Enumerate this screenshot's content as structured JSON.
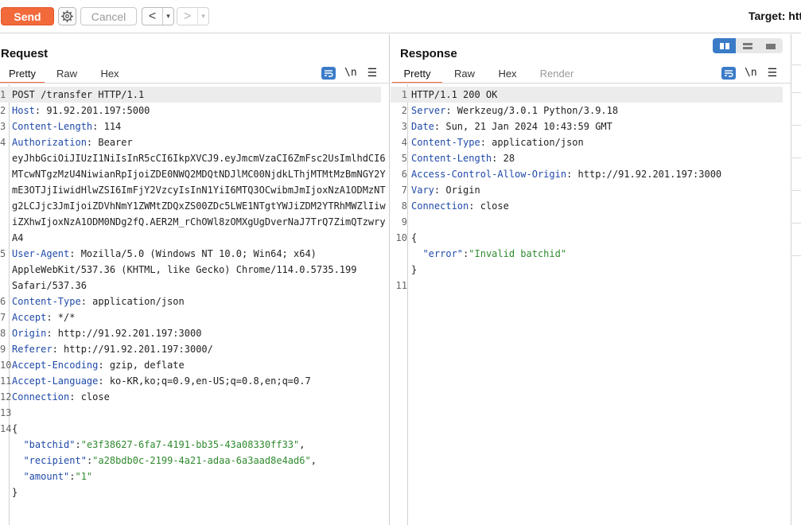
{
  "toolbar": {
    "send_label": "Send",
    "settings_icon": "gear-icon",
    "cancel_label": "Cancel",
    "back_glyph": "<",
    "forward_glyph": ">",
    "dropdown_glyph": "▾",
    "target_label": "Target: htt"
  },
  "request": {
    "title": "Request",
    "tabs": [
      "Pretty",
      "Raw",
      "Hex"
    ],
    "active_tab": "Pretty",
    "tool_nl": "\\n",
    "lines": [
      {
        "n": "1",
        "segments": [
          {
            "t": "POST /transfer HTTP/1.1",
            "c": ""
          }
        ],
        "hl": true
      },
      {
        "n": "2",
        "segments": [
          {
            "t": "Host",
            "c": "hdr"
          },
          {
            "t": ": 91.92.201.197:5000",
            "c": ""
          }
        ]
      },
      {
        "n": "3",
        "segments": [
          {
            "t": "Content-Length",
            "c": "hdr"
          },
          {
            "t": ": 114",
            "c": ""
          }
        ]
      },
      {
        "n": "4",
        "segments": [
          {
            "t": "Authorization",
            "c": "hdr"
          },
          {
            "t": ": Bearer",
            "c": ""
          }
        ]
      },
      {
        "n": "",
        "segments": [
          {
            "t": "eyJhbGciOiJIUzI1NiIsInR5cCI6IkpXVCJ9.eyJmcmVzaCI6ZmFsc2UsImlhdCI6",
            "c": ""
          }
        ]
      },
      {
        "n": "",
        "segments": [
          {
            "t": "MTcwNTgzMzU4NiwianRpIjoiZDE0NWQ2MDQtNDJlMC00NjdkLThjMTMtMzBmNGY2Y",
            "c": ""
          }
        ]
      },
      {
        "n": "",
        "segments": [
          {
            "t": "mE3OTJjIiwidHlwZSI6ImFjY2VzcyIsInN1YiI6MTQ3OCwibmJmIjoxNzA1ODMzNT",
            "c": ""
          }
        ]
      },
      {
        "n": "",
        "segments": [
          {
            "t": "g2LCJjc3JmIjoiZDVhNmY1ZWMtZDQxZS00ZDc5LWE1NTgtYWJiZDM2YTRhMWZlIiw",
            "c": ""
          }
        ]
      },
      {
        "n": "",
        "segments": [
          {
            "t": "iZXhwIjoxNzA1ODM0NDg2fQ.AER2M_rChOWl8zOMXgUgDverNaJ7TrQ7ZimQTzwry",
            "c": ""
          }
        ]
      },
      {
        "n": "",
        "segments": [
          {
            "t": "A4",
            "c": ""
          }
        ]
      },
      {
        "n": "5",
        "segments": [
          {
            "t": "User-Agent",
            "c": "hdr"
          },
          {
            "t": ": Mozilla/5.0 (Windows NT 10.0; Win64; x64)",
            "c": ""
          }
        ]
      },
      {
        "n": "",
        "segments": [
          {
            "t": "AppleWebKit/537.36 (KHTML, like Gecko) Chrome/114.0.5735.199",
            "c": ""
          }
        ]
      },
      {
        "n": "",
        "segments": [
          {
            "t": "Safari/537.36",
            "c": ""
          }
        ]
      },
      {
        "n": "6",
        "segments": [
          {
            "t": "Content-Type",
            "c": "hdr"
          },
          {
            "t": ": application/json",
            "c": ""
          }
        ]
      },
      {
        "n": "7",
        "segments": [
          {
            "t": "Accept",
            "c": "hdr"
          },
          {
            "t": ": */*",
            "c": ""
          }
        ]
      },
      {
        "n": "8",
        "segments": [
          {
            "t": "Origin",
            "c": "hdr"
          },
          {
            "t": ": http://91.92.201.197:3000",
            "c": ""
          }
        ]
      },
      {
        "n": "9",
        "segments": [
          {
            "t": "Referer",
            "c": "hdr"
          },
          {
            "t": ": http://91.92.201.197:3000/",
            "c": ""
          }
        ]
      },
      {
        "n": "10",
        "segments": [
          {
            "t": "Accept-Encoding",
            "c": "hdr"
          },
          {
            "t": ": gzip, deflate",
            "c": ""
          }
        ]
      },
      {
        "n": "11",
        "segments": [
          {
            "t": "Accept-Language",
            "c": "hdr"
          },
          {
            "t": ": ko-KR,ko;q=0.9,en-US;q=0.8,en;q=0.7",
            "c": ""
          }
        ]
      },
      {
        "n": "12",
        "segments": [
          {
            "t": "Connection",
            "c": "hdr"
          },
          {
            "t": ": close",
            "c": ""
          }
        ]
      },
      {
        "n": "13",
        "segments": []
      },
      {
        "n": "14",
        "segments": [
          {
            "t": "{",
            "c": ""
          }
        ]
      },
      {
        "n": "",
        "segments": [
          {
            "t": "  ",
            "c": ""
          },
          {
            "t": "\"batchid\"",
            "c": "json-key"
          },
          {
            "t": ":",
            "c": ""
          },
          {
            "t": "\"e3f38627-6fa7-4191-bb35-43a08330ff33\"",
            "c": "json-str"
          },
          {
            "t": ",",
            "c": ""
          }
        ]
      },
      {
        "n": "",
        "segments": [
          {
            "t": "  ",
            "c": ""
          },
          {
            "t": "\"recipient\"",
            "c": "json-key"
          },
          {
            "t": ":",
            "c": ""
          },
          {
            "t": "\"a28bdb0c-2199-4a21-adaa-6a3aad8e4ad6\"",
            "c": "json-str"
          },
          {
            "t": ",",
            "c": ""
          }
        ]
      },
      {
        "n": "",
        "segments": [
          {
            "t": "  ",
            "c": ""
          },
          {
            "t": "\"amount\"",
            "c": "json-key"
          },
          {
            "t": ":",
            "c": ""
          },
          {
            "t": "\"1\"",
            "c": "json-str"
          }
        ]
      },
      {
        "n": "",
        "segments": [
          {
            "t": "}",
            "c": ""
          }
        ]
      }
    ]
  },
  "response": {
    "title": "Response",
    "tabs": [
      "Pretty",
      "Raw",
      "Hex",
      "Render"
    ],
    "active_tab": "Pretty",
    "disabled_tab": "Render",
    "tool_nl": "\\n",
    "lines": [
      {
        "n": "1",
        "segments": [
          {
            "t": "HTTP/1.1 200 OK",
            "c": ""
          }
        ],
        "hl": true
      },
      {
        "n": "2",
        "segments": [
          {
            "t": "Server",
            "c": "hdr"
          },
          {
            "t": ": Werkzeug/3.0.1 Python/3.9.18",
            "c": ""
          }
        ]
      },
      {
        "n": "3",
        "segments": [
          {
            "t": "Date",
            "c": "hdr"
          },
          {
            "t": ": Sun, 21 Jan 2024 10:43:59 GMT",
            "c": ""
          }
        ]
      },
      {
        "n": "4",
        "segments": [
          {
            "t": "Content-Type",
            "c": "hdr"
          },
          {
            "t": ": application/json",
            "c": ""
          }
        ]
      },
      {
        "n": "5",
        "segments": [
          {
            "t": "Content-Length",
            "c": "hdr"
          },
          {
            "t": ": 28",
            "c": ""
          }
        ]
      },
      {
        "n": "6",
        "segments": [
          {
            "t": "Access-Control-Allow-Origin",
            "c": "hdr"
          },
          {
            "t": ": http://91.92.201.197:3000",
            "c": ""
          }
        ]
      },
      {
        "n": "7",
        "segments": [
          {
            "t": "Vary",
            "c": "hdr"
          },
          {
            "t": ": Origin",
            "c": ""
          }
        ]
      },
      {
        "n": "8",
        "segments": [
          {
            "t": "Connection",
            "c": "hdr"
          },
          {
            "t": ": close",
            "c": ""
          }
        ]
      },
      {
        "n": "9",
        "segments": []
      },
      {
        "n": "10",
        "segments": [
          {
            "t": "{",
            "c": ""
          }
        ]
      },
      {
        "n": "",
        "segments": [
          {
            "t": "  ",
            "c": ""
          },
          {
            "t": "\"error\"",
            "c": "json-key"
          },
          {
            "t": ":",
            "c": ""
          },
          {
            "t": "\"Invalid batchid\"",
            "c": "json-str"
          }
        ]
      },
      {
        "n": "",
        "segments": [
          {
            "t": "}",
            "c": ""
          }
        ]
      },
      {
        "n": "11",
        "segments": []
      }
    ]
  },
  "colors": {
    "accent": "#f2693a",
    "active_blue": "#3a7bc8",
    "header_name": "#1f4aa8",
    "json_string": "#2f8a2f"
  }
}
